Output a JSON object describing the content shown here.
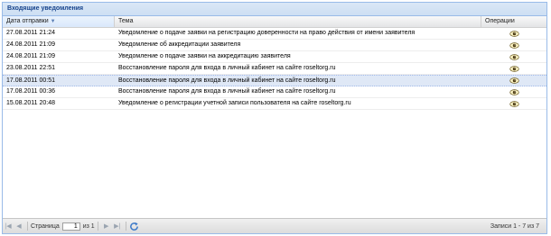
{
  "panel": {
    "title": "Входящие уведомления"
  },
  "columns": {
    "date": "Дата отправки",
    "topic": "Тема",
    "ops": "Операции"
  },
  "rows": [
    {
      "date": "27.08.2011 21:24",
      "topic": "Уведомление о подаче заявки на регистрацию доверенности на право действия от имени заявителя",
      "selected": false
    },
    {
      "date": "24.08.2011 21:09",
      "topic": "Уведомление об аккредитации заявителя",
      "selected": false
    },
    {
      "date": "24.08.2011 21:09",
      "topic": "Уведомление о подаче заявки на аккредитацию заявителя",
      "selected": false
    },
    {
      "date": "23.08.2011 22:51",
      "topic": "Восстановление пароля для входа в личный кабинет на сайте roseltorg.ru",
      "selected": false
    },
    {
      "date": "17.08.2011 00:51",
      "topic": "Восстановление пароля для входа в личный кабинет на сайте roseltorg.ru",
      "selected": true
    },
    {
      "date": "17.08.2011 00:36",
      "topic": "Восстановление пароля для входа в личный кабинет на сайте roseltorg.ru",
      "selected": false
    },
    {
      "date": "15.08.2011 20:48",
      "topic": "Уведомление о регистрации учетной записи пользователя на сайте roseltorg.ru",
      "selected": false
    }
  ],
  "pager": {
    "page_label": "Страница",
    "page_value": "1",
    "of_label": "из 1",
    "records_label": "Записи 1 - 7 из 7"
  },
  "colors": {
    "header": "#15428b",
    "selected_row": "#dfe8f6",
    "border": "#99bbe8"
  }
}
